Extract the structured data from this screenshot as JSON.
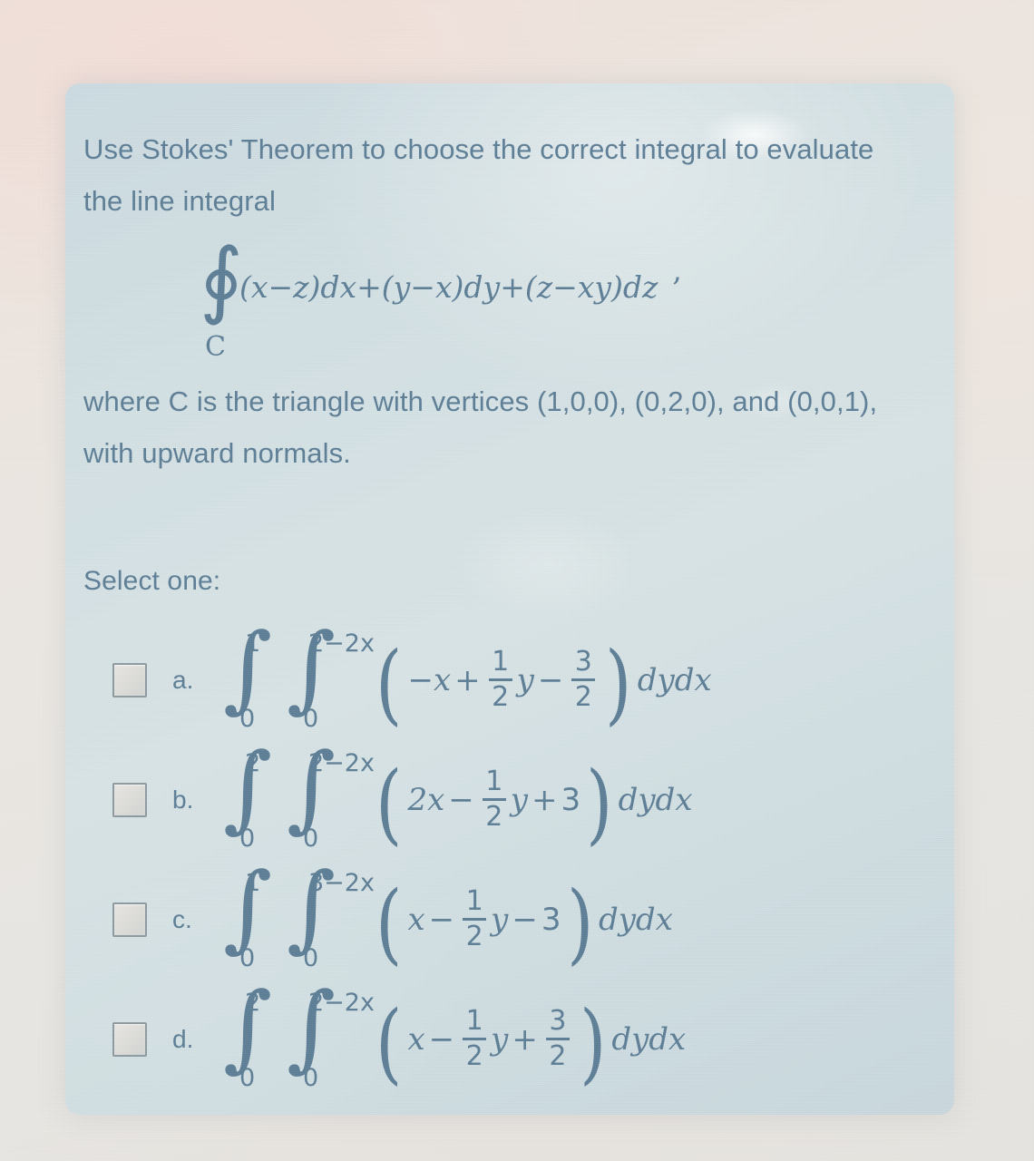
{
  "colors": {
    "panel_bg": "#d3e0e3",
    "page_bg": "#ece7e2",
    "text": "#5d7e96",
    "checkbox_border": "#8c9aa0"
  },
  "question": {
    "stem_line_1": "Use Stokes' Theorem to choose the correct integral to evaluate",
    "stem_line_2": "the line integral",
    "contour_integral": {
      "symbol": "∮",
      "subscript": "C",
      "body": "(x−z)dx+(y−x)dy+(z−xy)dz",
      "trailing_punctuation": ","
    },
    "condition_line_1": "where C is the triangle with vertices (1,0,0), (0,2,0), and (0,0,1),",
    "condition_line_2": "with upward normals."
  },
  "select_prompt": "Select one:",
  "options": [
    {
      "letter": "a.",
      "checked": false,
      "outer_lower": "0",
      "outer_upper": "1",
      "inner_lower": "0",
      "inner_upper": "2−2x",
      "integrand": {
        "term1": "−x",
        "op1": "+",
        "frac1_num": "1",
        "frac1_den": "2",
        "var1": "y",
        "op2": "−",
        "frac2_num": "3",
        "frac2_den": "2"
      },
      "differentials": "dydx",
      "plain_text": "∫₀¹ ∫₀^(2−2x) (−x + (1/2)y − 3/2) dydx"
    },
    {
      "letter": "b.",
      "checked": false,
      "outer_lower": "0",
      "outer_upper": "2",
      "inner_lower": "0",
      "inner_upper": "2−2x",
      "integrand": {
        "term1": "2x",
        "op1": "−",
        "frac1_num": "1",
        "frac1_den": "2",
        "var1": "y",
        "op2": "+",
        "tail": "3"
      },
      "differentials": "dydx",
      "plain_text": "∫₀² ∫₀^(2−2x) (2x − (1/2)y + 3) dydx"
    },
    {
      "letter": "c.",
      "checked": false,
      "outer_lower": "0",
      "outer_upper": "1",
      "inner_lower": "0",
      "inner_upper": "3−2x",
      "integrand": {
        "term1": "x",
        "op1": "−",
        "frac1_num": "1",
        "frac1_den": "2",
        "var1": "y",
        "op2": "−",
        "tail": "3"
      },
      "differentials": "dydx",
      "plain_text": "∫₀¹ ∫₀^(3−2x) (x − (1/2)y − 3) dydx"
    },
    {
      "letter": "d.",
      "checked": false,
      "outer_lower": "0",
      "outer_upper": "2",
      "inner_lower": "0",
      "inner_upper": "2−2x",
      "integrand": {
        "term1": "x",
        "op1": "−",
        "frac1_num": "1",
        "frac1_den": "2",
        "var1": "y",
        "op2": "+",
        "frac2_num": "3",
        "frac2_den": "2"
      },
      "differentials": "dydx",
      "plain_text": "∫₀² ∫₀^(2−2x) (x − (1/2)y + 3/2) dydx"
    }
  ],
  "icons": {
    "integral": "∫",
    "contour_integral": "∮",
    "checkbox": "checkbox-unchecked"
  }
}
